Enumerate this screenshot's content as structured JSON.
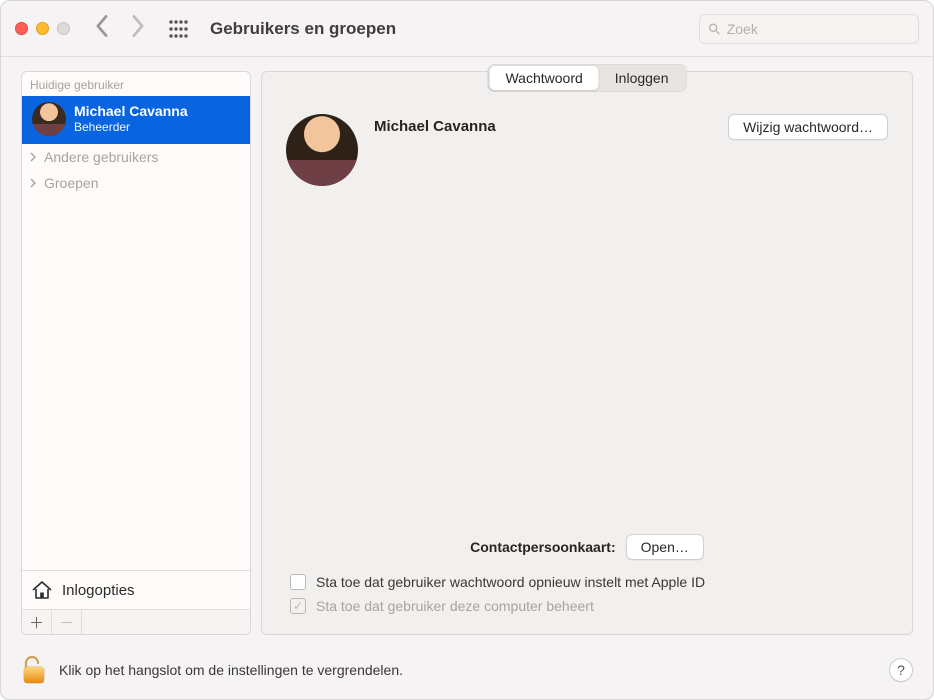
{
  "window": {
    "title": "Gebruikers en groepen",
    "search_placeholder": "Zoek"
  },
  "sidebar": {
    "current_label": "Huidige gebruiker",
    "current_user": {
      "name": "Michael Cavanna",
      "role": "Beheerder"
    },
    "others_label": "Andere gebruikers",
    "groups_label": "Groepen",
    "login_options_label": "Inlogopties"
  },
  "tabs": {
    "password": "Wachtwoord",
    "login": "Inloggen"
  },
  "main": {
    "user_name": "Michael Cavanna",
    "change_password_btn": "Wijzig wachtwoord…",
    "contacts_label": "Contactpersoonkaart:",
    "open_btn": "Open…",
    "chk_reset_pw": "Sta toe dat gebruiker wachtwoord opnieuw instelt met Apple ID",
    "chk_admin": "Sta toe dat gebruiker deze computer beheert"
  },
  "footer": {
    "text": "Klik op het hangslot om de instellingen te vergrendelen."
  }
}
